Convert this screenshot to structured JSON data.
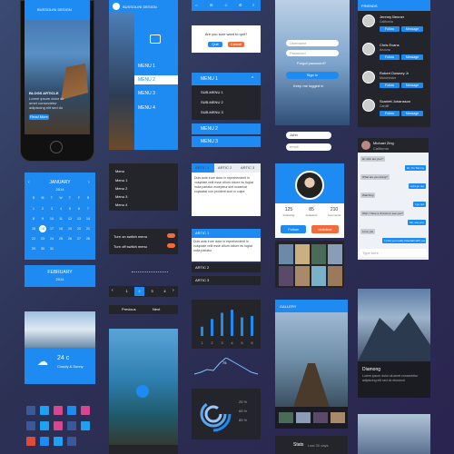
{
  "brand": "BUSSOLINI DESIGN",
  "phone": {
    "headline": "BUSSOLINI DESIGN",
    "article_title": "BLOGS ARTICLE",
    "article_text": "Lorem ipsum dolor sit amet consectetur adipiscing elit sed do eiusmod tempor",
    "read_more": "Read More"
  },
  "menu_panel": {
    "items": [
      "MENU 1",
      "MENU 2",
      "MENU 3",
      "MENU 4"
    ]
  },
  "nav_icons": [
    "home-icon",
    "mail-icon",
    "user-icon",
    "gear-icon",
    "menu-icon"
  ],
  "quit_dialog": {
    "question": "Are you sure want to quit?",
    "quit": "Quit",
    "cancel": "Cancel"
  },
  "accordion_menu": {
    "menu1": "MENU 1",
    "subs": [
      "SUB-MENU 1",
      "SUB-MENU 2",
      "SUB-MENU 3"
    ],
    "menu2": "MENU 2",
    "menu3": "MENU 3"
  },
  "login": {
    "username": "Username",
    "password": "Password",
    "forgot": "Forgot password?",
    "signin": "Sign In",
    "keep": "Keep me logged in"
  },
  "name_fields": {
    "name": "John",
    "email": "email"
  },
  "friends": {
    "title": "FRIENDS",
    "list": [
      {
        "name": "Jeremy Benner",
        "city": "California"
      },
      {
        "name": "Chris Evans",
        "city": "Arizona"
      },
      {
        "name": "Robert Downey Jr",
        "city": "Manchester"
      },
      {
        "name": "Scarlett Johansson",
        "city": "Cardiff"
      }
    ],
    "follow": "Follow",
    "message": "Message"
  },
  "calendar": {
    "month": "JANUARY",
    "year": "2014",
    "days": [
      "S",
      "M",
      "T",
      "W",
      "T",
      "F",
      "S"
    ],
    "dates": [
      [
        1,
        2,
        3,
        4,
        5,
        6,
        7
      ],
      [
        8,
        9,
        10,
        11,
        12,
        13,
        14
      ],
      [
        15,
        16,
        17,
        18,
        19,
        20,
        21
      ],
      [
        22,
        23,
        24,
        25,
        26,
        27,
        28
      ],
      [
        29,
        30,
        31,
        "",
        "",
        "",
        ""
      ]
    ],
    "today": 16,
    "month2": "FEBRUARY",
    "year2": "2014"
  },
  "simple_menu": {
    "title": "Menu",
    "items": [
      "Menu 1",
      "Menu 2",
      "Menu 3",
      "Menu 4"
    ]
  },
  "articles_tabs": {
    "tabs": [
      "ARTIC 1",
      "ARTIC 2",
      "ARTIC 3"
    ],
    "body": "Duis aute irure dolor in reprehenderit in voluptate velit esse cillum dolore eu fugiat nulla pariatur excepteur sint occaecat cupidatat non proident sunt in culpa"
  },
  "profile": {
    "stats": [
      {
        "n": "125",
        "l": "Following"
      },
      {
        "n": "85",
        "l": "Followers"
      },
      {
        "n": "210",
        "l": "Comments"
      }
    ],
    "follow": "Follow",
    "unfollow": "Unfollow"
  },
  "chat": {
    "name": "Michael Zing",
    "city": "California",
    "messages": [
      "Hi, who are you?",
      "Hi, I'm Tommy",
      "What are you doing?",
      "Let's go out",
      "Watching",
      "I go out",
      "Well, I have a chance to see you?",
      "Ok, see you",
      "Love you",
      "I miss you really baseball with you"
    ],
    "placeholder": "Type here"
  },
  "switches": {
    "on": "Turn on switch menu",
    "off": "Turn off switch menu"
  },
  "articles_accordion": {
    "items": [
      "ARTIC 1",
      "ARTIC 2",
      "ARTIC 3"
    ],
    "body": "Duis aute irure dolor in reprehenderit in voluptate velit esse cillum dolore eu fugiat nulla pariatur"
  },
  "pagination": {
    "pages": [
      "1",
      "2",
      "3",
      "4"
    ],
    "active": "2",
    "prev": "Previous",
    "next": "Next"
  },
  "weather": {
    "temp": "24 c",
    "desc": "Cloudy & Sunny"
  },
  "bar_chart": {
    "labels": [
      "1",
      "2",
      "3",
      "4",
      "5",
      "6"
    ],
    "values": [
      0.3,
      0.55,
      0.75,
      0.85,
      0.6,
      0.65
    ]
  },
  "line_chart": {
    "value": "75",
    "values": [
      10,
      12,
      15,
      14,
      22,
      28,
      24,
      20,
      16,
      12,
      10
    ]
  },
  "gallery": {
    "title": "GALLERY"
  },
  "diamond": {
    "title": "Diamong",
    "text": "Lorem ipsum dolor sit amet consectetur adipiscing elit sed do eiusmod"
  },
  "donut": {
    "legend": [
      "25 %",
      "65 %",
      "85 %"
    ],
    "values": [
      0.25,
      0.65,
      0.85
    ]
  },
  "stats_footer": {
    "title": "Stats",
    "sub": "Last 30 days"
  },
  "colors": {
    "blue": "#1d8bf1",
    "dark": "#23252b",
    "orange": "#f26b3a",
    "pink": "#d6478f"
  }
}
